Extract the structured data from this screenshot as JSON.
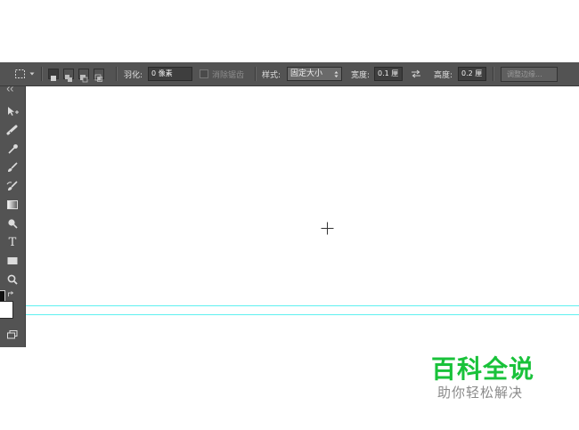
{
  "options_bar": {
    "feather_label": "羽化:",
    "feather_value": "0 像素",
    "antialias_label": "消除锯齿",
    "style_label": "样式:",
    "style_value": "固定大小",
    "width_label": "宽度:",
    "width_value": "0.1 厘",
    "height_label": "高度:",
    "height_value": "0.2 厘",
    "refine_edge_label": "调整边缘..."
  },
  "toolbar": {
    "type_tool_glyph": "T"
  },
  "watermark": {
    "title": "百科全说",
    "subtitle": "助你轻松解决"
  },
  "colors": {
    "panel": "#535353",
    "guide": "#5ff0f0",
    "watermark_green": "#19c23a"
  },
  "icons": [
    "marquee-icon",
    "move-icon",
    "healing-brush-icon",
    "eyedropper-icon",
    "brush-icon",
    "history-brush-icon",
    "gradient-icon",
    "dodge-icon",
    "type-icon",
    "shape-icon",
    "zoom-icon",
    "swap-colors-icon",
    "screen-mode-icon",
    "crosshair-cursor-icon"
  ]
}
